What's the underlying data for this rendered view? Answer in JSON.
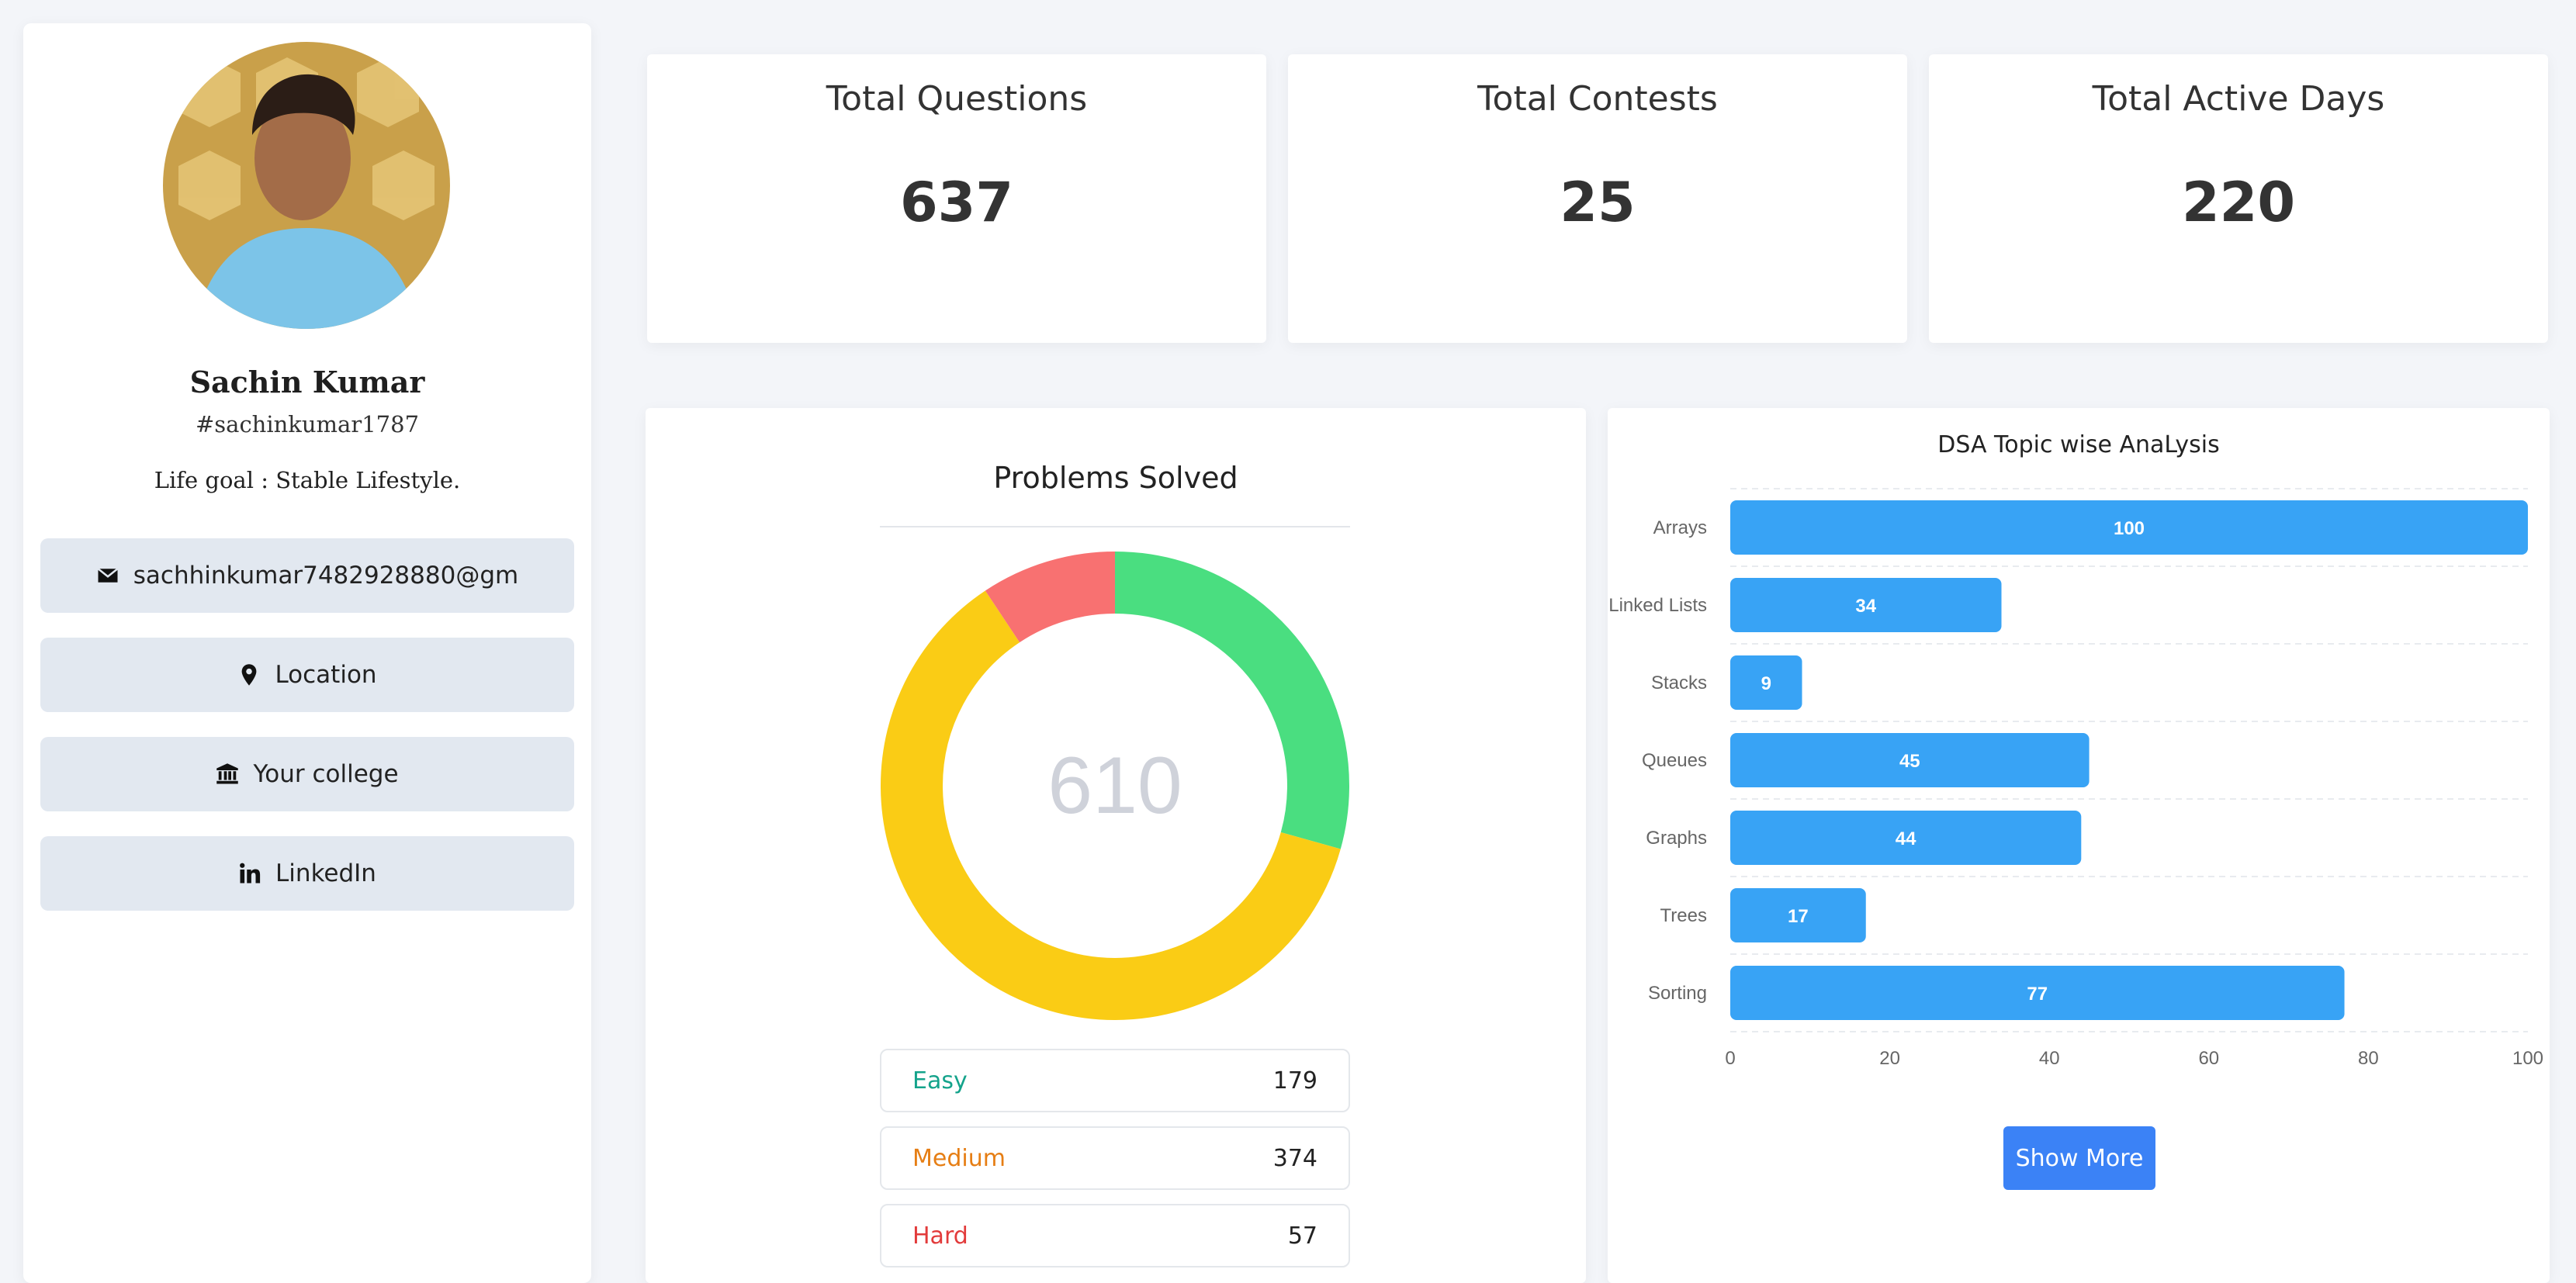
{
  "profile": {
    "name": "Sachin Kumar",
    "handle": "#sachinkumar1787",
    "life_goal": "Life goal : Stable Lifestyle.",
    "links": [
      {
        "icon": "envelope-icon",
        "label": "sachhinkumar7482928880@gm"
      },
      {
        "icon": "location-pin-icon",
        "label": "Location"
      },
      {
        "icon": "college-building-icon",
        "label": "Your college"
      },
      {
        "icon": "linkedin-icon",
        "label": "LinkedIn"
      }
    ]
  },
  "stats": [
    {
      "label": "Total Questions",
      "value": "637"
    },
    {
      "label": "Total Contests",
      "value": "25"
    },
    {
      "label": "Total Active Days",
      "value": "220"
    }
  ],
  "problems": {
    "title": "Problems Solved",
    "total": "610",
    "levels": [
      {
        "label": "Easy",
        "count": "179",
        "color": "#14a38b",
        "ring_color": "#4ade80"
      },
      {
        "label": "Medium",
        "count": "374",
        "color": "#e67e14",
        "ring_color": "#facc15"
      },
      {
        "label": "Hard",
        "count": "57",
        "color": "#e23b3b",
        "ring_color": "#f87171"
      }
    ]
  },
  "dsa": {
    "show_more_label": "Show More"
  },
  "colors": {
    "bar": "#38a3f5",
    "button": "#3b82f6",
    "background": "#f3f5f9"
  },
  "chart_data": {
    "type": "bar",
    "orientation": "horizontal",
    "title": "DSA Topic wise AnaLysis",
    "categories": [
      "Arrays",
      "Linked Lists",
      "Stacks",
      "Queues",
      "Graphs",
      "Trees",
      "Sorting"
    ],
    "values": [
      100,
      34,
      9,
      45,
      44,
      17,
      77
    ],
    "xlim": [
      0,
      100
    ],
    "xticks": [
      0,
      20,
      40,
      60,
      80,
      100
    ],
    "grid": true
  }
}
